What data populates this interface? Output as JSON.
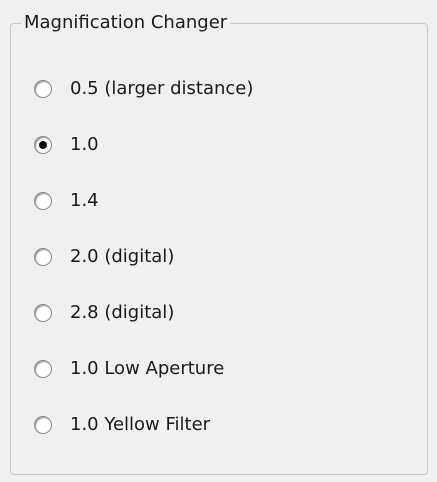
{
  "group": {
    "title": "Magnification Changer",
    "options": [
      {
        "label": "0.5 (larger distance)",
        "checked": false
      },
      {
        "label": "1.0",
        "checked": true
      },
      {
        "label": "1.4",
        "checked": false
      },
      {
        "label": "2.0 (digital)",
        "checked": false
      },
      {
        "label": "2.8 (digital)",
        "checked": false
      },
      {
        "label": "1.0 Low Aperture",
        "checked": false
      },
      {
        "label": "1.0 Yellow Filter",
        "checked": false
      }
    ]
  }
}
